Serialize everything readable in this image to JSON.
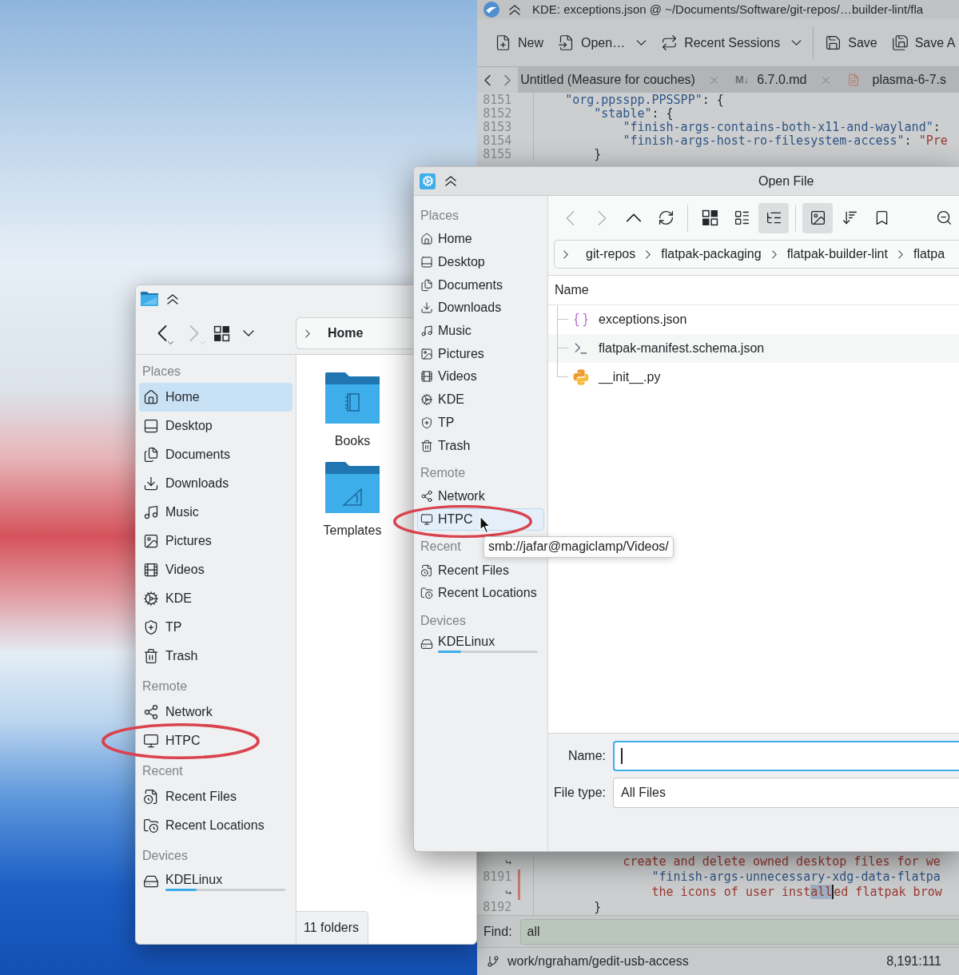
{
  "editor_window": {
    "title": "KDE: exceptions.json @ ~/Documents/Software/git-repos/…builder-lint/fla",
    "toolbar": [
      {
        "kind": "new",
        "label": "New",
        "dropdown": false
      },
      {
        "kind": "open",
        "label": "Open…",
        "dropdown": true
      },
      {
        "kind": "sessions",
        "label": "Recent Sessions",
        "dropdown": true
      },
      {
        "kind": "separator"
      },
      {
        "kind": "save",
        "label": "Save",
        "dropdown": false
      },
      {
        "kind": "save-as",
        "label": "Save A",
        "dropdown": false
      }
    ],
    "tabs": [
      {
        "kind": "plain",
        "label": "Untitled (Measure for couches)",
        "closable": true
      },
      {
        "kind": "markdown",
        "badge": "M↓",
        "label": "6.7.0.md",
        "closable": true
      },
      {
        "kind": "document",
        "label": "plasma-6-7.s",
        "closable": false
      }
    ],
    "code_top": [
      {
        "kind": "line",
        "gutter": "8151",
        "modified": false,
        "segments": [
          {
            "kind": "key",
            "text": "    \"org.ppsspp.PPSSPP\""
          },
          {
            "kind": "punct",
            "text": ": {"
          }
        ]
      },
      {
        "kind": "line",
        "gutter": "8152",
        "modified": false,
        "segments": [
          {
            "kind": "key",
            "text": "        \"stable\""
          },
          {
            "kind": "punct",
            "text": ": {"
          }
        ]
      },
      {
        "kind": "line",
        "gutter": "8153",
        "modified": false,
        "segments": [
          {
            "kind": "key",
            "text": "            \"finish-args-contains-both-x11-and-wayland\""
          },
          {
            "kind": "punct",
            "text": ":"
          }
        ]
      },
      {
        "kind": "line",
        "gutter": "8154",
        "modified": false,
        "segments": [
          {
            "kind": "key",
            "text": "            \"finish-args-host-ro-filesystem-access\""
          },
          {
            "kind": "punct",
            "text": ": "
          },
          {
            "kind": "string",
            "text": "\"Pre"
          }
        ]
      },
      {
        "kind": "line",
        "gutter": "8155",
        "modified": false,
        "segments": [
          {
            "kind": "punct",
            "text": "        }"
          }
        ]
      }
    ],
    "code_bottom": [
      {
        "kind": "continuation",
        "gutter": "↪",
        "modified": false,
        "segments": [
          {
            "kind": "string",
            "text": "            create and delete owned desktop files for we"
          }
        ]
      },
      {
        "kind": "line",
        "gutter": "8191",
        "modified": true,
        "segments": [
          {
            "kind": "key",
            "text": "                \"finish-args-unnecessary-xdg-data-flatpa"
          }
        ]
      },
      {
        "kind": "continuation",
        "gutter": "↪",
        "modified": true,
        "segments": [
          {
            "kind": "string",
            "text": "                the icons of user inst"
          },
          {
            "kind": "match",
            "text": "all"
          },
          {
            "kind": "string",
            "text": "ed flatpak brow"
          }
        ]
      },
      {
        "kind": "line",
        "gutter": "8192",
        "modified": false,
        "segments": [
          {
            "kind": "punct",
            "text": "        }"
          }
        ]
      }
    ],
    "find": {
      "label": "Find:",
      "value": "all",
      "match_found": true
    },
    "status_bar": {
      "branch": "work/ngraham/gedit-usb-access",
      "position": "8,191:111"
    }
  },
  "file_manager": {
    "toolbar": [
      {
        "kind": "back",
        "disabled": false
      },
      {
        "kind": "forward",
        "disabled": true
      },
      {
        "kind": "view-mode",
        "disabled": false
      },
      {
        "kind": "view-menu",
        "disabled": false
      }
    ],
    "breadcrumb": [
      {
        "label": "Home",
        "current": true
      }
    ],
    "sidebar": [
      {
        "header": "Places",
        "items": [
          {
            "label": "Home",
            "kind": "home",
            "selected": true,
            "circled": false
          },
          {
            "label": "Desktop",
            "kind": "desktop",
            "selected": false,
            "circled": false
          },
          {
            "label": "Documents",
            "kind": "documents",
            "selected": false,
            "circled": false
          },
          {
            "label": "Downloads",
            "kind": "downloads",
            "selected": false,
            "circled": false
          },
          {
            "label": "Music",
            "kind": "music",
            "selected": false,
            "circled": false
          },
          {
            "label": "Pictures",
            "kind": "pictures",
            "selected": false,
            "circled": false
          },
          {
            "label": "Videos",
            "kind": "videos",
            "selected": false,
            "circled": false
          },
          {
            "label": "KDE",
            "kind": "kde",
            "selected": false,
            "circled": false
          },
          {
            "label": "TP",
            "kind": "tp",
            "selected": false,
            "circled": false
          },
          {
            "label": "Trash",
            "kind": "trash",
            "selected": false,
            "circled": false
          }
        ]
      },
      {
        "header": "Remote",
        "items": [
          {
            "label": "Network",
            "kind": "network",
            "selected": false,
            "circled": false
          },
          {
            "label": "HTPC",
            "kind": "remote-folder",
            "selected": false,
            "circled": true
          }
        ]
      },
      {
        "header": "Recent",
        "items": [
          {
            "label": "Recent Files",
            "kind": "recent-files",
            "selected": false,
            "circled": false
          },
          {
            "label": "Recent Locations",
            "kind": "recent-locations",
            "selected": false,
            "circled": false
          }
        ]
      },
      {
        "header": "Devices",
        "items": [
          {
            "label": "KDELinux",
            "kind": "drive",
            "selected": false,
            "circled": false,
            "level": 0.26
          }
        ]
      }
    ],
    "items": [
      {
        "kind": "books",
        "name": "Books"
      },
      {
        "kind": "templates",
        "name": "Templates"
      }
    ],
    "status": "11 folders"
  },
  "open_file_dialog": {
    "title": "Open File",
    "toolbar": [
      {
        "kind": "back",
        "disabled": true,
        "pressed": false
      },
      {
        "kind": "forward",
        "disabled": true,
        "pressed": false
      },
      {
        "kind": "up",
        "disabled": false,
        "pressed": false
      },
      {
        "kind": "reload",
        "disabled": false,
        "pressed": false
      },
      {
        "kind": "separator"
      },
      {
        "kind": "icons-view",
        "disabled": false,
        "pressed": false
      },
      {
        "kind": "compact-view",
        "disabled": false,
        "pressed": false
      },
      {
        "kind": "tree-view",
        "disabled": false,
        "pressed": true
      },
      {
        "kind": "separator"
      },
      {
        "kind": "preview",
        "disabled": false,
        "pressed": true
      },
      {
        "kind": "sort",
        "disabled": false,
        "pressed": false
      },
      {
        "kind": "bookmarks",
        "disabled": false,
        "pressed": false
      },
      {
        "kind": "zoom-out",
        "disabled": false,
        "pressed": false
      }
    ],
    "breadcrumb": [
      {
        "label": "git-repos",
        "current": false
      },
      {
        "label": "flatpak-packaging",
        "current": false
      },
      {
        "label": "flatpak-builder-lint",
        "current": false
      },
      {
        "label": "flatpa",
        "current": false
      }
    ],
    "sidebar": [
      {
        "header": "Places",
        "items": [
          {
            "label": "Home",
            "kind": "home",
            "selected": false,
            "hovered": false,
            "circled": false
          },
          {
            "label": "Desktop",
            "kind": "desktop",
            "selected": false,
            "hovered": false,
            "circled": false
          },
          {
            "label": "Documents",
            "kind": "documents",
            "selected": false,
            "hovered": false,
            "circled": false
          },
          {
            "label": "Downloads",
            "kind": "downloads",
            "selected": false,
            "hovered": false,
            "circled": false
          },
          {
            "label": "Music",
            "kind": "music",
            "selected": false,
            "hovered": false,
            "circled": false
          },
          {
            "label": "Pictures",
            "kind": "pictures",
            "selected": false,
            "hovered": false,
            "circled": false
          },
          {
            "label": "Videos",
            "kind": "videos",
            "selected": false,
            "hovered": false,
            "circled": false
          },
          {
            "label": "KDE",
            "kind": "kde",
            "selected": false,
            "hovered": false,
            "circled": false
          },
          {
            "label": "TP",
            "kind": "tp",
            "selected": false,
            "hovered": false,
            "circled": false
          },
          {
            "label": "Trash",
            "kind": "trash",
            "selected": false,
            "hovered": false,
            "circled": false
          }
        ]
      },
      {
        "header": "Remote",
        "items": [
          {
            "label": "Network",
            "kind": "network",
            "selected": false,
            "hovered": false,
            "circled": false
          },
          {
            "label": "HTPC",
            "kind": "remote-folder",
            "selected": false,
            "hovered": true,
            "circled": true,
            "tooltip": "smb://jafar@magiclamp/Videos/"
          }
        ]
      },
      {
        "header": "Recent",
        "items": [
          {
            "label": "Recent Files",
            "kind": "recent-files",
            "selected": false,
            "hovered": false,
            "circled": false
          },
          {
            "label": "Recent Locations",
            "kind": "recent-locations",
            "selected": false,
            "hovered": false,
            "circled": false
          }
        ]
      },
      {
        "header": "Devices",
        "items": [
          {
            "label": "KDELinux",
            "kind": "drive",
            "selected": false,
            "hovered": false,
            "circled": false,
            "level": 0.23
          }
        ]
      }
    ],
    "column_header": "Name",
    "files": [
      {
        "kind": "json",
        "name": "exceptions.json"
      },
      {
        "kind": "script",
        "name": "flatpak-manifest.schema.json"
      },
      {
        "kind": "python",
        "name": "__init__.py"
      }
    ],
    "name_field": {
      "label": "Name:",
      "focused": true
    },
    "file_type": {
      "label": "File type:",
      "value": "All Files"
    }
  }
}
